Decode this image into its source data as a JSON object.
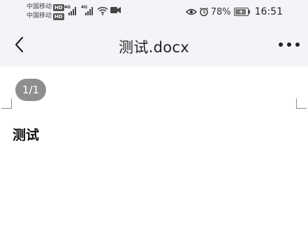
{
  "status_bar": {
    "carrier_1": "中国移动",
    "carrier_2": "中国移动",
    "hd_badge": "HD",
    "signal_1_gen": "4G",
    "signal_2_gen": "4G",
    "battery_percent": "78%",
    "time": "16:51",
    "icons": [
      "eye-icon",
      "alarm-icon",
      "battery-icon",
      "wifi-icon",
      "video-icon"
    ]
  },
  "header": {
    "title": "测试.docx",
    "back_icon": "chevron-left-icon",
    "more_icon": "more-horizontal-icon"
  },
  "document": {
    "page_indicator": "1/1",
    "body_text": "测试"
  },
  "colors": {
    "bar_background": "#f5f3f7",
    "page_indicator_bg": "#8e8e8e"
  }
}
